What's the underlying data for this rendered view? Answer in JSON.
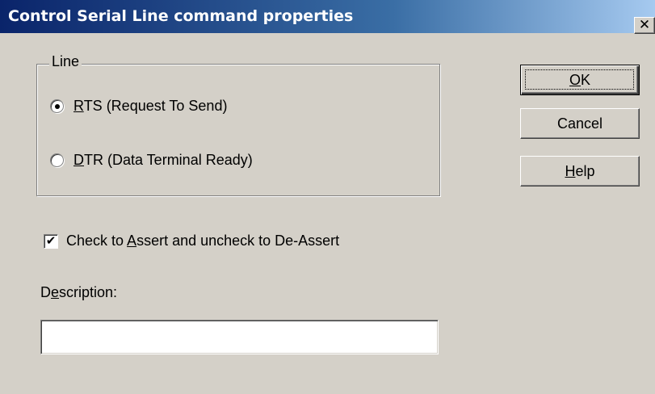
{
  "window": {
    "title": "Control Serial Line command properties",
    "close_glyph": "✕",
    "close_icon": "close-icon"
  },
  "line_group": {
    "label": "Line",
    "options": [
      {
        "accel": "R",
        "rest": "TS (Request To Send)",
        "selected": true
      },
      {
        "accel": "D",
        "rest": "TR (Data Terminal Ready)",
        "selected": false
      }
    ]
  },
  "assert_checkbox": {
    "pre": "Check to ",
    "accel": "A",
    "post": "ssert and uncheck to De-Assert",
    "checked": true,
    "check_glyph": "✔"
  },
  "description": {
    "pre": "D",
    "accel": "e",
    "post": "scription:",
    "value": ""
  },
  "buttons": {
    "ok": {
      "accel": "O",
      "rest": "K"
    },
    "cancel": {
      "label": "Cancel"
    },
    "help": {
      "accel": "H",
      "rest": "elp"
    }
  },
  "colors": {
    "face": "#d4d0c8",
    "title_start": "#0a246a",
    "title_end": "#a6caf0"
  }
}
